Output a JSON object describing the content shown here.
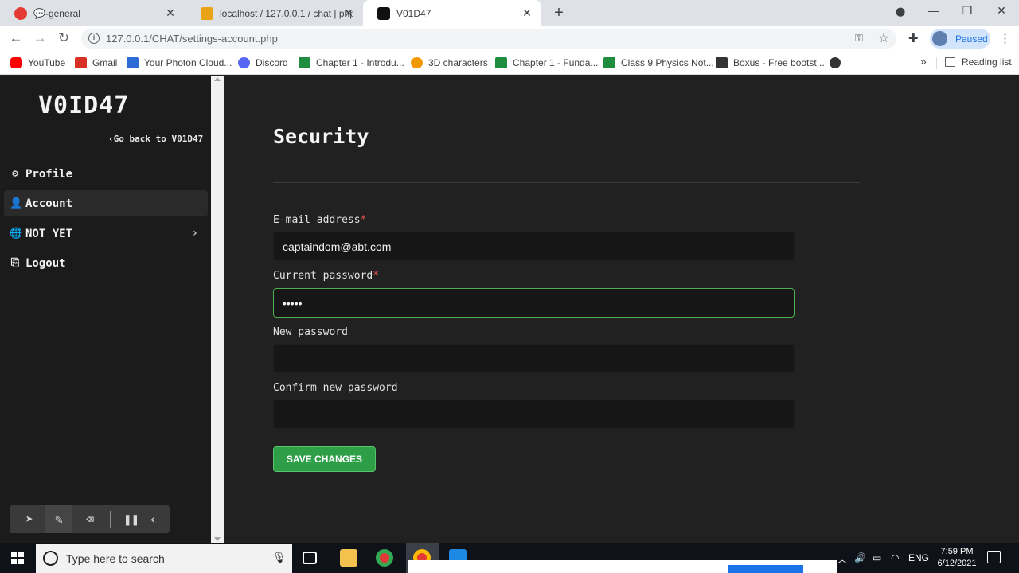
{
  "browser": {
    "tabs": [
      {
        "title": "💬-general",
        "favicon_color": "#e53935",
        "active": false
      },
      {
        "title": "localhost / 127.0.0.1 / chat | phpM",
        "favicon_color": "#e8a317",
        "active": false
      },
      {
        "title": "V01D47",
        "favicon_color": "#111111",
        "active": true
      }
    ],
    "url": "127.0.0.1/CHAT/settings-account.php",
    "profile_status": "Paused",
    "bookmarks": [
      {
        "label": "YouTube",
        "color": "#ff0000"
      },
      {
        "label": "Gmail",
        "color": "#d93025"
      },
      {
        "label": "Your Photon Cloud...",
        "color": "#2d6bd6"
      },
      {
        "label": "Discord",
        "color": "#5865f2"
      },
      {
        "label": "Chapter 1 - Introdu...",
        "color": "#1e8e3e"
      },
      {
        "label": "3D characters",
        "color": "#f29900"
      },
      {
        "label": "Chapter 1 - Funda...",
        "color": "#1e8e3e"
      },
      {
        "label": "Class 9 Physics Not...",
        "color": "#1e8e3e"
      },
      {
        "label": "Boxus - Free bootst...",
        "color": "#333333"
      }
    ],
    "reading_list": "Reading list"
  },
  "sidebar": {
    "logo": "V0ID47",
    "go_back": "Go back to V01D47",
    "items": [
      {
        "label": "Profile",
        "icon": "gear-icon"
      },
      {
        "label": "Account",
        "icon": "user-icon"
      },
      {
        "label": "NOT YET",
        "icon": "globe-icon"
      },
      {
        "label": "Logout",
        "icon": "logout-icon"
      }
    ]
  },
  "main": {
    "heading": "Security",
    "email_label": "E-mail address",
    "email_value": "captaindom@abt.com",
    "current_password_label": "Current password",
    "current_password_value": "•••••",
    "new_password_label": "New password",
    "confirm_password_label": "Confirm new password",
    "save_label": "SAVE CHANGES",
    "required_mark": "*"
  },
  "taskbar": {
    "search_placeholder": "Type here to search",
    "language": "ENG",
    "time": "7:59 PM",
    "date": "6/12/2021"
  },
  "colors": {
    "accent_green": "#2e9e47",
    "required_red": "#e05252",
    "page_bg": "#212121"
  }
}
